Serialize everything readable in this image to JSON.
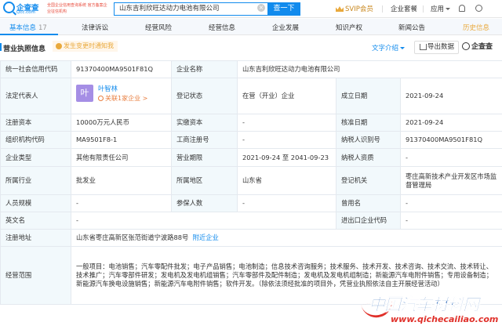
{
  "header": {
    "logo_name": "企查查",
    "logo_sub": "Qcc.com",
    "slogan": "全国企业信用查询系统 官方备案企业征信机构",
    "search_value": "山东吉利欣旺达动力电池有限公司",
    "search_button": "查一下",
    "svip_label": "SVIP会员",
    "nav": [
      "企业套餐",
      "应用"
    ]
  },
  "tabs": {
    "items": [
      {
        "label": "基本信息",
        "count": "17"
      },
      {
        "label": "法律诉讼"
      },
      {
        "label": "经营风险"
      },
      {
        "label": "经营信息"
      },
      {
        "label": "企业发展"
      },
      {
        "label": "知识产权"
      },
      {
        "label": "新闻公告"
      },
      {
        "label": "历史信息"
      }
    ]
  },
  "section": {
    "title": "营业执照信息",
    "notice": "发生变更时通知我",
    "text_intro": "文字介绍",
    "export_label": "导出数据",
    "brand_mark": "企查查"
  },
  "rows": {
    "r1": {
      "l1": "统一社会信用代码",
      "v1": "91370400MA9501F81Q",
      "l2": "企业名称",
      "v2": "山东吉利欣旺达动力电池有限公司"
    },
    "r2": {
      "l1": "法定代表人",
      "avatar": "叶",
      "rep_name": "叶智林",
      "rep_assoc": "关联1家企业 >",
      "l2": "登记状态",
      "v2": "在营（开业）企业",
      "l3": "成立日期",
      "v3": "2021-09-24"
    },
    "r3": {
      "l1": "注册资本",
      "v1": "10000万元人民币",
      "l2": "实缴资本",
      "v2": "-",
      "l3": "核准日期",
      "v3": "2021-09-24"
    },
    "r4": {
      "l1": "组织机构代码",
      "v1": "MA9501F8-1",
      "l2": "工商注册号",
      "v2": "-",
      "l3": "纳税人识别号",
      "v3": "91370400MA9501F81Q"
    },
    "r5": {
      "l1": "企业类型",
      "v1": "其他有限责任公司",
      "l2": "营业期限",
      "v2": "2021-09-24 至 2041-09-23",
      "l3": "纳税人资质",
      "v3": "-"
    },
    "r6": {
      "l1": "所属行业",
      "v1": "批发业",
      "l2": "所属地区",
      "v2": "山东省",
      "l3": "登记机关",
      "v3": "枣庄高新技术产业开发区市场监督管理局"
    },
    "r7": {
      "l1": "人员规模",
      "v1": "-",
      "l2": "参保人数",
      "v2": "-",
      "l3": "曾用名",
      "v3": "-"
    },
    "r8": {
      "l1": "英文名",
      "v1": "-",
      "l3": "进出口企业代码",
      "v3": "-"
    },
    "r9": {
      "l1": "注册地址",
      "v1": "山东省枣庄高新区张范街道宁波路88号",
      "link": "附近企业"
    },
    "r10": {
      "l1": "经营范围",
      "v1": "一般项目：电池销售；汽车零配件批发；电子产品销售；电池制造；信息技术咨询服务；技术服务、技术开发、技术咨询、技术交流、技术转让、技术推广；汽车零部件研发；发电机及发电机组销售；汽车零部件及配件制造；发电机及发电机组制造；新能源汽车电附件销售；专用设备制造；新能源汽车换电设施销售；新能源汽车电附件销售；软件开发。（除依法须经批准的项目外，凭营业执照依法自主开展经营活动）"
    }
  },
  "watermark": {
    "title": "中国汽车材料网",
    "url": "www.qichecailiao.com"
  },
  "colors": {
    "brand": "#128bed",
    "label_bg": "#f2f9fc",
    "border": "#e4e9ef",
    "svip": "#c8861b"
  }
}
